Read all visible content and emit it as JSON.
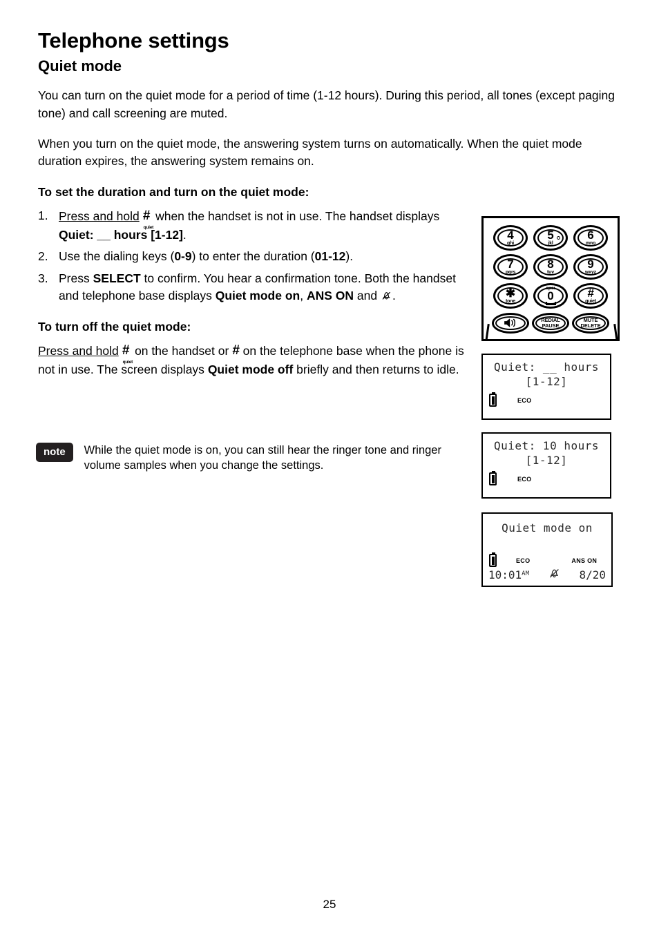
{
  "document": {
    "chapter_title": "Telephone settings",
    "section_title": "Quiet mode",
    "page_number": "25"
  },
  "intro": {
    "paragraph_1": "You can turn on the quiet mode for a period of time (1-12 hours). During this period, all tones (except paging tone) and call screening are muted.",
    "paragraph_2": "When you turn on the quiet mode, the answering system turns on automatically. When the quiet mode duration expires, the answering system remains on."
  },
  "set_duration": {
    "heading": "To set the duration and turn on the quiet mode:",
    "steps": [
      {
        "num": "1.",
        "part_a": "Press and hold",
        "key_label": "#",
        "key_sub": "quiet",
        "part_b": "when the handset is not in use. The handset displays",
        "bold_1": "Quiet: __ hours [1-12]",
        "part_c": "."
      },
      {
        "num": "2.",
        "part_a": "Use the dialing keys (",
        "bold_1": "0-9",
        "part_b": ") to enter the duration (",
        "bold_2": "01-12",
        "part_c": ")."
      },
      {
        "num": "3.",
        "part_a": "Press",
        "bold_1": "SELECT",
        "part_b": "to confirm. You hear a confirmation tone. Both the handset and telephone base displays",
        "bold_2": "Quiet mode on",
        "sep": ",",
        "bold_3": "ANS ON",
        "part_c": "and",
        "part_d": "."
      }
    ]
  },
  "turn_off": {
    "heading": "To turn off the quiet mode:",
    "part_a": "Press and hold",
    "key_label": "#",
    "key_sub": "quiet",
    "part_b": "on the handset or",
    "key_label_2": "#",
    "part_c": "on the telephone base when the phone is not in use. The screen displays",
    "bold_1": "Quiet mode off",
    "part_d": "briefly and then returns to idle."
  },
  "note": {
    "badge": "note",
    "text": "While the quiet mode is on, you can still hear the ringer tone and ringer volume samples when you change the settings."
  },
  "keypad": {
    "keys": [
      {
        "digit": "4",
        "letters": "ghi"
      },
      {
        "digit": "5",
        "letters": "jkl",
        "marker": "dot"
      },
      {
        "digit": "6",
        "letters": "mno"
      },
      {
        "digit": "7",
        "letters": "pqrs"
      },
      {
        "digit": "8",
        "letters": "tuv"
      },
      {
        "digit": "9",
        "letters": "wxyz"
      },
      {
        "digit": "✱",
        "letters": "tone"
      },
      {
        "digit": "0",
        "letters": "",
        "over": "oper"
      },
      {
        "digit": "#",
        "letters": "quiet"
      }
    ],
    "function_keys": [
      {
        "label": "speaker-icon",
        "icon": "speaker"
      },
      {
        "label": "REDIAL\nPAUSE",
        "line1": "REDIAL",
        "line2": "PAUSE"
      },
      {
        "label": "MUTE\nDELETE",
        "line1": "MUTE",
        "line2": "DELETE"
      }
    ]
  },
  "lcd_screens": [
    {
      "line1": "Quiet: __ hours",
      "line2": "[1-12]",
      "battery": "full",
      "eco": "ECO"
    },
    {
      "line1": "Quiet: 10 hours",
      "line2": "[1-12]",
      "battery": "full",
      "eco": "ECO"
    },
    {
      "line1": "Quiet mode on",
      "line2": "",
      "battery": "full",
      "eco": "ECO",
      "ans_on": "ANS ON",
      "time": "10:01",
      "ampm": "AM",
      "mute_icon": "bell-crossed",
      "message_count": "8/20"
    }
  ],
  "colors": {
    "text": "#000000",
    "note_badge_bg": "#231f20",
    "lcd_text": "#2b2b2b"
  }
}
